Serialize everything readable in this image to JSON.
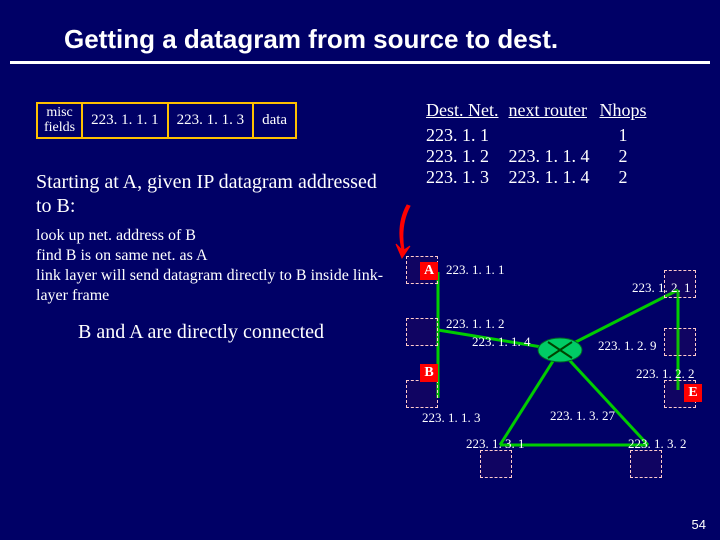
{
  "title": "Getting a datagram from source to dest.",
  "packet": {
    "misc_top": "misc",
    "misc_bot": "fields",
    "src": "223. 1. 1. 1",
    "dst": "223. 1. 1. 3",
    "data": "data"
  },
  "start_text": "Starting at A, given IP datagram addressed to B:",
  "bullets": "look up net. address of B\nfind B is on same net. as A\nlink layer will send datagram directly to B inside link-layer frame",
  "conclusion": "B and A are directly connected",
  "routing_table": {
    "h1": "Dest. Net.",
    "h2": "next router",
    "h3": "Nhops",
    "r1c1": "223. 1. 1",
    "r1c2": "",
    "r1c3": "1",
    "r2c1": "223. 1. 2",
    "r2c2": "223. 1. 1. 4",
    "r2c3": "2",
    "r3c1": "223. 1. 3",
    "r3c2": "223. 1. 1. 4",
    "r3c3": "2"
  },
  "labels": {
    "A": "A",
    "B": "B",
    "E": "E"
  },
  "ips": {
    "a": "223. 1. 1. 1",
    "a2": "223. 1. 1. 2",
    "rl": "223. 1. 1. 4",
    "b": "223. 1. 1. 3",
    "c1": "223. 1. 2. 1",
    "c2": "223. 1. 2. 9",
    "c3": "223. 1. 2. 2",
    "d1": "223. 1. 3. 27",
    "d2": "223. 1. 3. 1",
    "d3": "223. 1. 3. 2"
  },
  "page": "54"
}
